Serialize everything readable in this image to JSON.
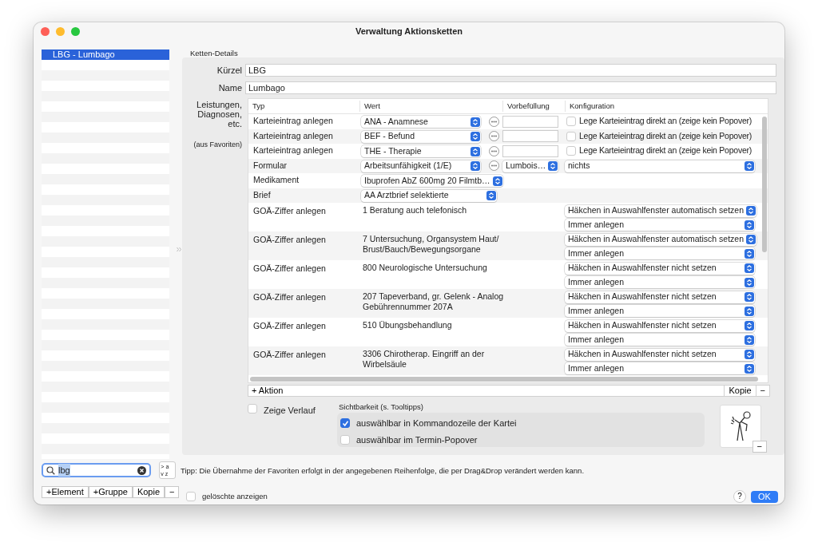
{
  "window": {
    "title": "Verwaltung Aktionsketten"
  },
  "sidebar": {
    "items": [
      {
        "label": "LBG - Lumbago",
        "selected": true
      }
    ],
    "search": {
      "value": "lbg"
    },
    "sort_buttons": [
      "> a",
      "v z"
    ],
    "buttons": [
      "+Element",
      "+Gruppe",
      "Kopie",
      "−"
    ]
  },
  "details": {
    "caption": "Ketten-Details",
    "fields": [
      {
        "label": "Kürzel",
        "value": "LBG"
      },
      {
        "label": "Name",
        "value": "Lumbago"
      }
    ],
    "actions_label": "Leistungen, Diagnosen, etc.",
    "favorites_note": "(aus Favoriten)",
    "table": {
      "columns": [
        "Typ",
        "Wert",
        "Vorbefüllung",
        "Konfiguration"
      ],
      "rows": [
        {
          "kind": "entry",
          "type": "Karteieintrag anlegen",
          "value": "ANA - Anamnese",
          "option": {
            "label": "Lege Karteieintrag direkt an (zeige kein Popover)",
            "checked": false
          }
        },
        {
          "kind": "entry",
          "type": "Karteieintrag anlegen",
          "value": "BEF - Befund",
          "option": {
            "label": "Lege Karteieintrag direkt an (zeige kein Popover)",
            "checked": false
          }
        },
        {
          "kind": "entry",
          "type": "Karteieintrag anlegen",
          "value": "THE - Therapie",
          "option": {
            "label": "Lege Karteieintrag direkt an (zeige kein Popover)",
            "checked": false
          }
        },
        {
          "kind": "form",
          "type": "Formular",
          "value": "Arbeitsunfähigkeit (1/E)",
          "prefill": "Lumbois…",
          "config": [
            "nichts"
          ]
        },
        {
          "kind": "select",
          "type": "Medikament",
          "value": "Ibuprofen AbZ 600mg 20 Filmtb…"
        },
        {
          "kind": "select",
          "type": "Brief",
          "value": "AA Arztbrief selektierte"
        },
        {
          "kind": "fee",
          "type": "GOÄ-Ziffer anlegen",
          "value": "1 Beratung auch telefonisch",
          "config": [
            "Häkchen in Auswahlfenster automatisch setzen",
            "Immer anlegen"
          ]
        },
        {
          "kind": "fee",
          "type": "GOÄ-Ziffer anlegen",
          "value": "7 Untersuchung, Organsystem Haut/ Brust/Bauch/Bewegungsorgane",
          "config": [
            "Häkchen in Auswahlfenster automatisch setzen",
            "Immer anlegen"
          ]
        },
        {
          "kind": "fee",
          "type": "GOÄ-Ziffer anlegen",
          "value": "800 Neurologische Untersuchung",
          "config": [
            "Häkchen in Auswahlfenster nicht setzen",
            "Immer anlegen"
          ]
        },
        {
          "kind": "fee",
          "type": "GOÄ-Ziffer anlegen",
          "value": "207 Tapeverband, gr. Gelenk - Analog Gebührennummer 207A",
          "config": [
            "Häkchen in Auswahlfenster nicht setzen",
            "Immer anlegen"
          ]
        },
        {
          "kind": "fee",
          "type": "GOÄ-Ziffer anlegen",
          "value": "510 Übungsbehandlung",
          "config": [
            "Häkchen in Auswahlfenster nicht setzen",
            "Immer anlegen"
          ]
        },
        {
          "kind": "fee",
          "type": "GOÄ-Ziffer anlegen",
          "value": "3306 Chirotherap. Eingriff an der Wirbelsäule",
          "config": [
            "Häkchen in Auswahlfenster nicht setzen",
            "Immer anlegen"
          ]
        }
      ]
    },
    "toolbar": {
      "add": "+ Aktion",
      "buttons": [
        "Kopie",
        "−"
      ]
    },
    "show_history": {
      "label": "Zeige Verlauf",
      "checked": false
    },
    "visibility": {
      "title": "Sichtbarkeit (s. Tooltipps)",
      "options": [
        {
          "label": "auswählbar in Kommandozeile der Kartei",
          "checked": true
        },
        {
          "label": "auswählbar im Termin-Popover",
          "checked": false
        }
      ]
    },
    "image_remove": "−"
  },
  "tip": "Tipp: Die Übernahme der Favoriten erfolgt in der angegebenen Reihenfolge, die per Drag&Drop verändert werden kann.",
  "show_deleted": {
    "label": "gelöschte anzeigen",
    "checked": false
  },
  "help": "?",
  "ok": "OK"
}
